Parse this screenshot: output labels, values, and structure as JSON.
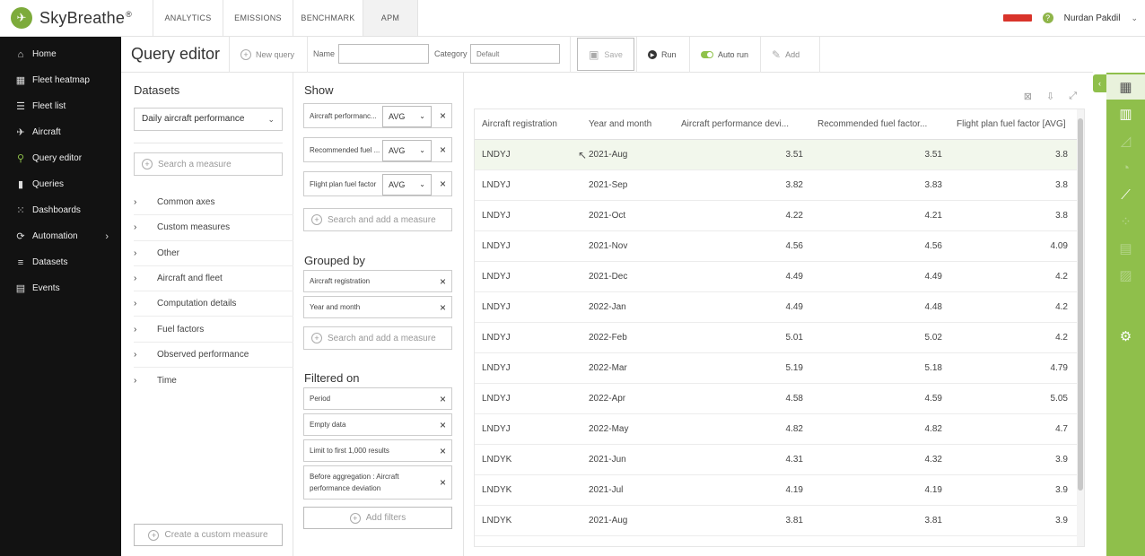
{
  "app": {
    "name": "SkyBreathe",
    "logo_glyph": "✈"
  },
  "topnav": {
    "tabs": [
      {
        "label": "ANALYTICS"
      },
      {
        "label": "EMISSIONS"
      },
      {
        "label": "BENCHMARK"
      },
      {
        "label": "APM"
      }
    ],
    "active_tab": "APM",
    "help_glyph": "?",
    "user_name": "Nurdan Pakdil"
  },
  "sidebar": {
    "items": [
      {
        "label": "Home",
        "icon": "home-icon",
        "glyph": "⌂"
      },
      {
        "label": "Fleet heatmap",
        "icon": "grid-icon",
        "glyph": "▦"
      },
      {
        "label": "Fleet list",
        "icon": "list-icon",
        "glyph": "☰"
      },
      {
        "label": "Aircraft",
        "icon": "plane-icon",
        "glyph": "✈"
      },
      {
        "label": "Query editor",
        "icon": "search-icon",
        "glyph": "⚲"
      },
      {
        "label": "Queries",
        "icon": "bar-chart-icon",
        "glyph": "▮"
      },
      {
        "label": "Dashboards",
        "icon": "dashboard-icon",
        "glyph": "⁙"
      },
      {
        "label": "Automation",
        "icon": "automation-icon",
        "glyph": "⟳"
      },
      {
        "label": "Datasets",
        "icon": "database-icon",
        "glyph": "≡"
      },
      {
        "label": "Events",
        "icon": "calendar-icon",
        "glyph": "▤"
      }
    ],
    "active": "Query editor"
  },
  "query_header": {
    "title": "Query editor",
    "new_query": "New query",
    "name_label": "Name",
    "name_value": "",
    "category_label": "Category",
    "category_placeholder": "Default",
    "save": "Save",
    "run": "Run",
    "auto_run": "Auto run",
    "add": "Add"
  },
  "datasets": {
    "title": "Datasets",
    "selected": "Daily aircraft performance",
    "search_placeholder": "Search a measure",
    "categories": [
      "Common axes",
      "Custom measures",
      "Other",
      "Aircraft and fleet",
      "Computation details",
      "Fuel factors",
      "Observed performance",
      "Time"
    ],
    "create_custom": "Create a custom measure"
  },
  "show": {
    "title": "Show",
    "measures": [
      {
        "label": "Aircraft performanc...",
        "agg": "AVG"
      },
      {
        "label": "Recommended fuel ...",
        "agg": "AVG"
      },
      {
        "label": "Flight plan fuel factor",
        "agg": "AVG"
      }
    ],
    "search_add": "Search and add a measure"
  },
  "grouped_by": {
    "title": "Grouped by",
    "items": [
      "Aircraft registration",
      "Year and month"
    ],
    "search_add": "Search and add a measure"
  },
  "filtered_on": {
    "title": "Filtered on",
    "items": [
      "Period",
      "Empty data",
      "Limit to first 1,000 results",
      "Before aggregation : Aircraft performance deviation"
    ],
    "add_filters": "Add filters"
  },
  "results": {
    "columns": [
      "Aircraft registration",
      "Year and month",
      "Aircraft performance devi...",
      "Recommended fuel factor...",
      "Flight plan fuel factor [AVG]"
    ],
    "rows": [
      [
        "LNDYJ",
        "2021-Aug",
        "3.51",
        "3.51",
        "3.8"
      ],
      [
        "LNDYJ",
        "2021-Sep",
        "3.82",
        "3.83",
        "3.8"
      ],
      [
        "LNDYJ",
        "2021-Oct",
        "4.22",
        "4.21",
        "3.8"
      ],
      [
        "LNDYJ",
        "2021-Nov",
        "4.56",
        "4.56",
        "4.09"
      ],
      [
        "LNDYJ",
        "2021-Dec",
        "4.49",
        "4.49",
        "4.2"
      ],
      [
        "LNDYJ",
        "2022-Jan",
        "4.49",
        "4.48",
        "4.2"
      ],
      [
        "LNDYJ",
        "2022-Feb",
        "5.01",
        "5.02",
        "4.2"
      ],
      [
        "LNDYJ",
        "2022-Mar",
        "5.19",
        "5.18",
        "4.79"
      ],
      [
        "LNDYJ",
        "2022-Apr",
        "4.58",
        "4.59",
        "5.05"
      ],
      [
        "LNDYJ",
        "2022-May",
        "4.82",
        "4.82",
        "4.7"
      ],
      [
        "LNDYK",
        "2021-Jun",
        "4.31",
        "4.32",
        "3.9"
      ],
      [
        "LNDYK",
        "2021-Jul",
        "4.19",
        "4.19",
        "3.9"
      ],
      [
        "LNDYK",
        "2021-Aug",
        "3.81",
        "3.81",
        "3.9"
      ]
    ]
  },
  "colors": {
    "accent": "#8fbf4b",
    "sidebar_bg": "#121212",
    "highlight_row": "#f2f7ec"
  }
}
